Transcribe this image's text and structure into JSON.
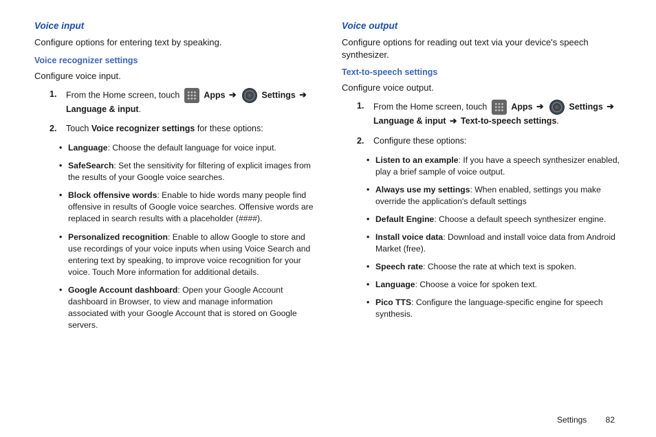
{
  "left": {
    "title": "Voice input",
    "intro": "Configure options for entering text by speaking.",
    "subTitle": "Voice recognizer settings",
    "subIntro": "Configure voice input.",
    "step1": {
      "num": "1.",
      "a": "From the Home screen, touch",
      "apps": "Apps",
      "arrow": "➔",
      "settings": "Settings",
      "arrow2": "➔",
      "lang": "Language & input"
    },
    "step2": {
      "num": "2.",
      "a": "Touch",
      "b": "Voice recognizer settings",
      "c": "for these options:"
    },
    "bullets": [
      {
        "bold": "Language",
        "rest": ": Choose the default language for voice input."
      },
      {
        "bold": "SafeSearch",
        "rest": ": Set the sensitivity for filtering of explicit images from the results of your Google voice searches."
      },
      {
        "bold": "Block offensive words",
        "rest": ": Enable to hide words many people find offensive in results of Google voice searches. Offensive words are replaced in search results with a placeholder (####)."
      },
      {
        "bold": "Personalized recognition",
        "rest": ": Enable to allow Google to store and use recordings of your voice inputs when using Voice Search and entering text by speaking, to improve voice recognition for your voice. Touch More information for additional details."
      },
      {
        "bold": "Google Account dashboard",
        "rest": ": Open your Google Account dashboard in Browser, to view and manage information associated with your Google Account that is stored on Google servers."
      }
    ]
  },
  "right": {
    "title": "Voice output",
    "intro": "Configure options for reading out text via your device's speech synthesizer.",
    "subTitle": "Text-to-speech settings",
    "subIntro": "Configure voice output.",
    "step1": {
      "num": "1.",
      "a": "From the Home screen, touch",
      "apps": "Apps",
      "arrow": "➔",
      "settings": "Settings",
      "arrow2": "➔",
      "lang": "Language & input",
      "arrow3": "➔",
      "tts": "Text-to-speech settings"
    },
    "step2": {
      "num": "2.",
      "a": "Configure these options:"
    },
    "bullets": [
      {
        "bold": "Listen to an example",
        "rest": ": If you have a speech synthesizer enabled, play a brief sample of voice output."
      },
      {
        "bold": "Always use my settings",
        "rest": ": When enabled, settings you make override the application's default settings"
      },
      {
        "bold": "Default Engine",
        "rest": ": Choose a default speech synthesizer engine."
      },
      {
        "bold": "Install voice data",
        "rest": ": Download and install voice data from Android Market (free)."
      },
      {
        "bold": "Speech rate",
        "rest": ": Choose the rate at which text is spoken."
      },
      {
        "bold": "Language",
        "rest": ": Choose a voice for spoken text."
      },
      {
        "bold": "Pico TTS",
        "rest": ": Configure the language-specific engine for speech synthesis."
      }
    ]
  },
  "footer": {
    "section": "Settings",
    "page": "82"
  }
}
